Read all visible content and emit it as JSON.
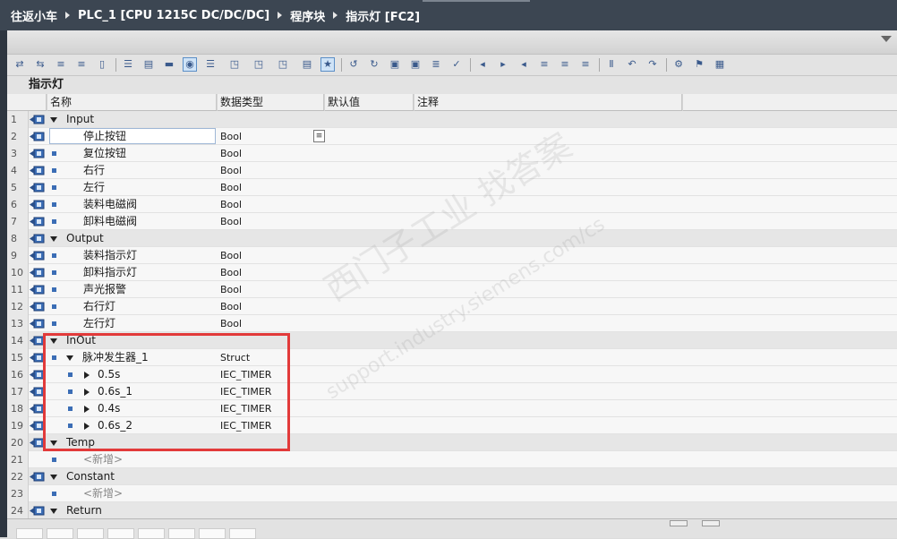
{
  "breadcrumb": [
    "往返小车",
    "PLC_1 [CPU 1215C DC/DC/DC]",
    "程序块",
    "指示灯 [FC2]"
  ],
  "block_name": "指示灯",
  "columns": {
    "name": "名称",
    "data_type": "数据类型",
    "default": "默认值",
    "comment": "注释"
  },
  "rows": [
    {
      "num": "1",
      "kind": "section",
      "name": "Input",
      "type": ""
    },
    {
      "num": "2",
      "kind": "item",
      "name": "停止按钮",
      "type": "Bool"
    },
    {
      "num": "3",
      "kind": "item",
      "name": "复位按钮",
      "type": "Bool"
    },
    {
      "num": "4",
      "kind": "item",
      "name": "右行",
      "type": "Bool"
    },
    {
      "num": "5",
      "kind": "item",
      "name": "左行",
      "type": "Bool"
    },
    {
      "num": "6",
      "kind": "item",
      "name": "装料电磁阀",
      "type": "Bool"
    },
    {
      "num": "7",
      "kind": "item",
      "name": "卸料电磁阀",
      "type": "Bool"
    },
    {
      "num": "8",
      "kind": "section",
      "name": "Output",
      "type": ""
    },
    {
      "num": "9",
      "kind": "item",
      "name": "装料指示灯",
      "type": "Bool"
    },
    {
      "num": "10",
      "kind": "item",
      "name": "卸料指示灯",
      "type": "Bool"
    },
    {
      "num": "11",
      "kind": "item",
      "name": "声光报警",
      "type": "Bool"
    },
    {
      "num": "12",
      "kind": "item",
      "name": "右行灯",
      "type": "Bool"
    },
    {
      "num": "13",
      "kind": "item",
      "name": "左行灯",
      "type": "Bool"
    },
    {
      "num": "14",
      "kind": "section",
      "name": "InOut",
      "type": ""
    },
    {
      "num": "15",
      "kind": "struct",
      "name": "脉冲发生器_1",
      "type": "Struct"
    },
    {
      "num": "16",
      "kind": "member",
      "name": "0.5s",
      "type": "IEC_TIMER"
    },
    {
      "num": "17",
      "kind": "member",
      "name": "0.6s_1",
      "type": "IEC_TIMER"
    },
    {
      "num": "18",
      "kind": "member",
      "name": "0.4s",
      "type": "IEC_TIMER"
    },
    {
      "num": "19",
      "kind": "member",
      "name": "0.6s_2",
      "type": "IEC_TIMER"
    },
    {
      "num": "20",
      "kind": "section",
      "name": "Temp",
      "type": ""
    },
    {
      "num": "21",
      "kind": "add",
      "name": "<新增>",
      "type": ""
    },
    {
      "num": "22",
      "kind": "section",
      "name": "Constant",
      "type": ""
    },
    {
      "num": "23",
      "kind": "add",
      "name": "<新增>",
      "type": ""
    },
    {
      "num": "24",
      "kind": "section",
      "name": "Return",
      "type": ""
    }
  ],
  "watermark": {
    "line1": "西门子工业 找答案",
    "line2": "support.industry.siemens.com/cs"
  },
  "colors": {
    "titlebar": "#3c4652",
    "highlight": "#e23a3a",
    "icon": "#3b6db5"
  }
}
